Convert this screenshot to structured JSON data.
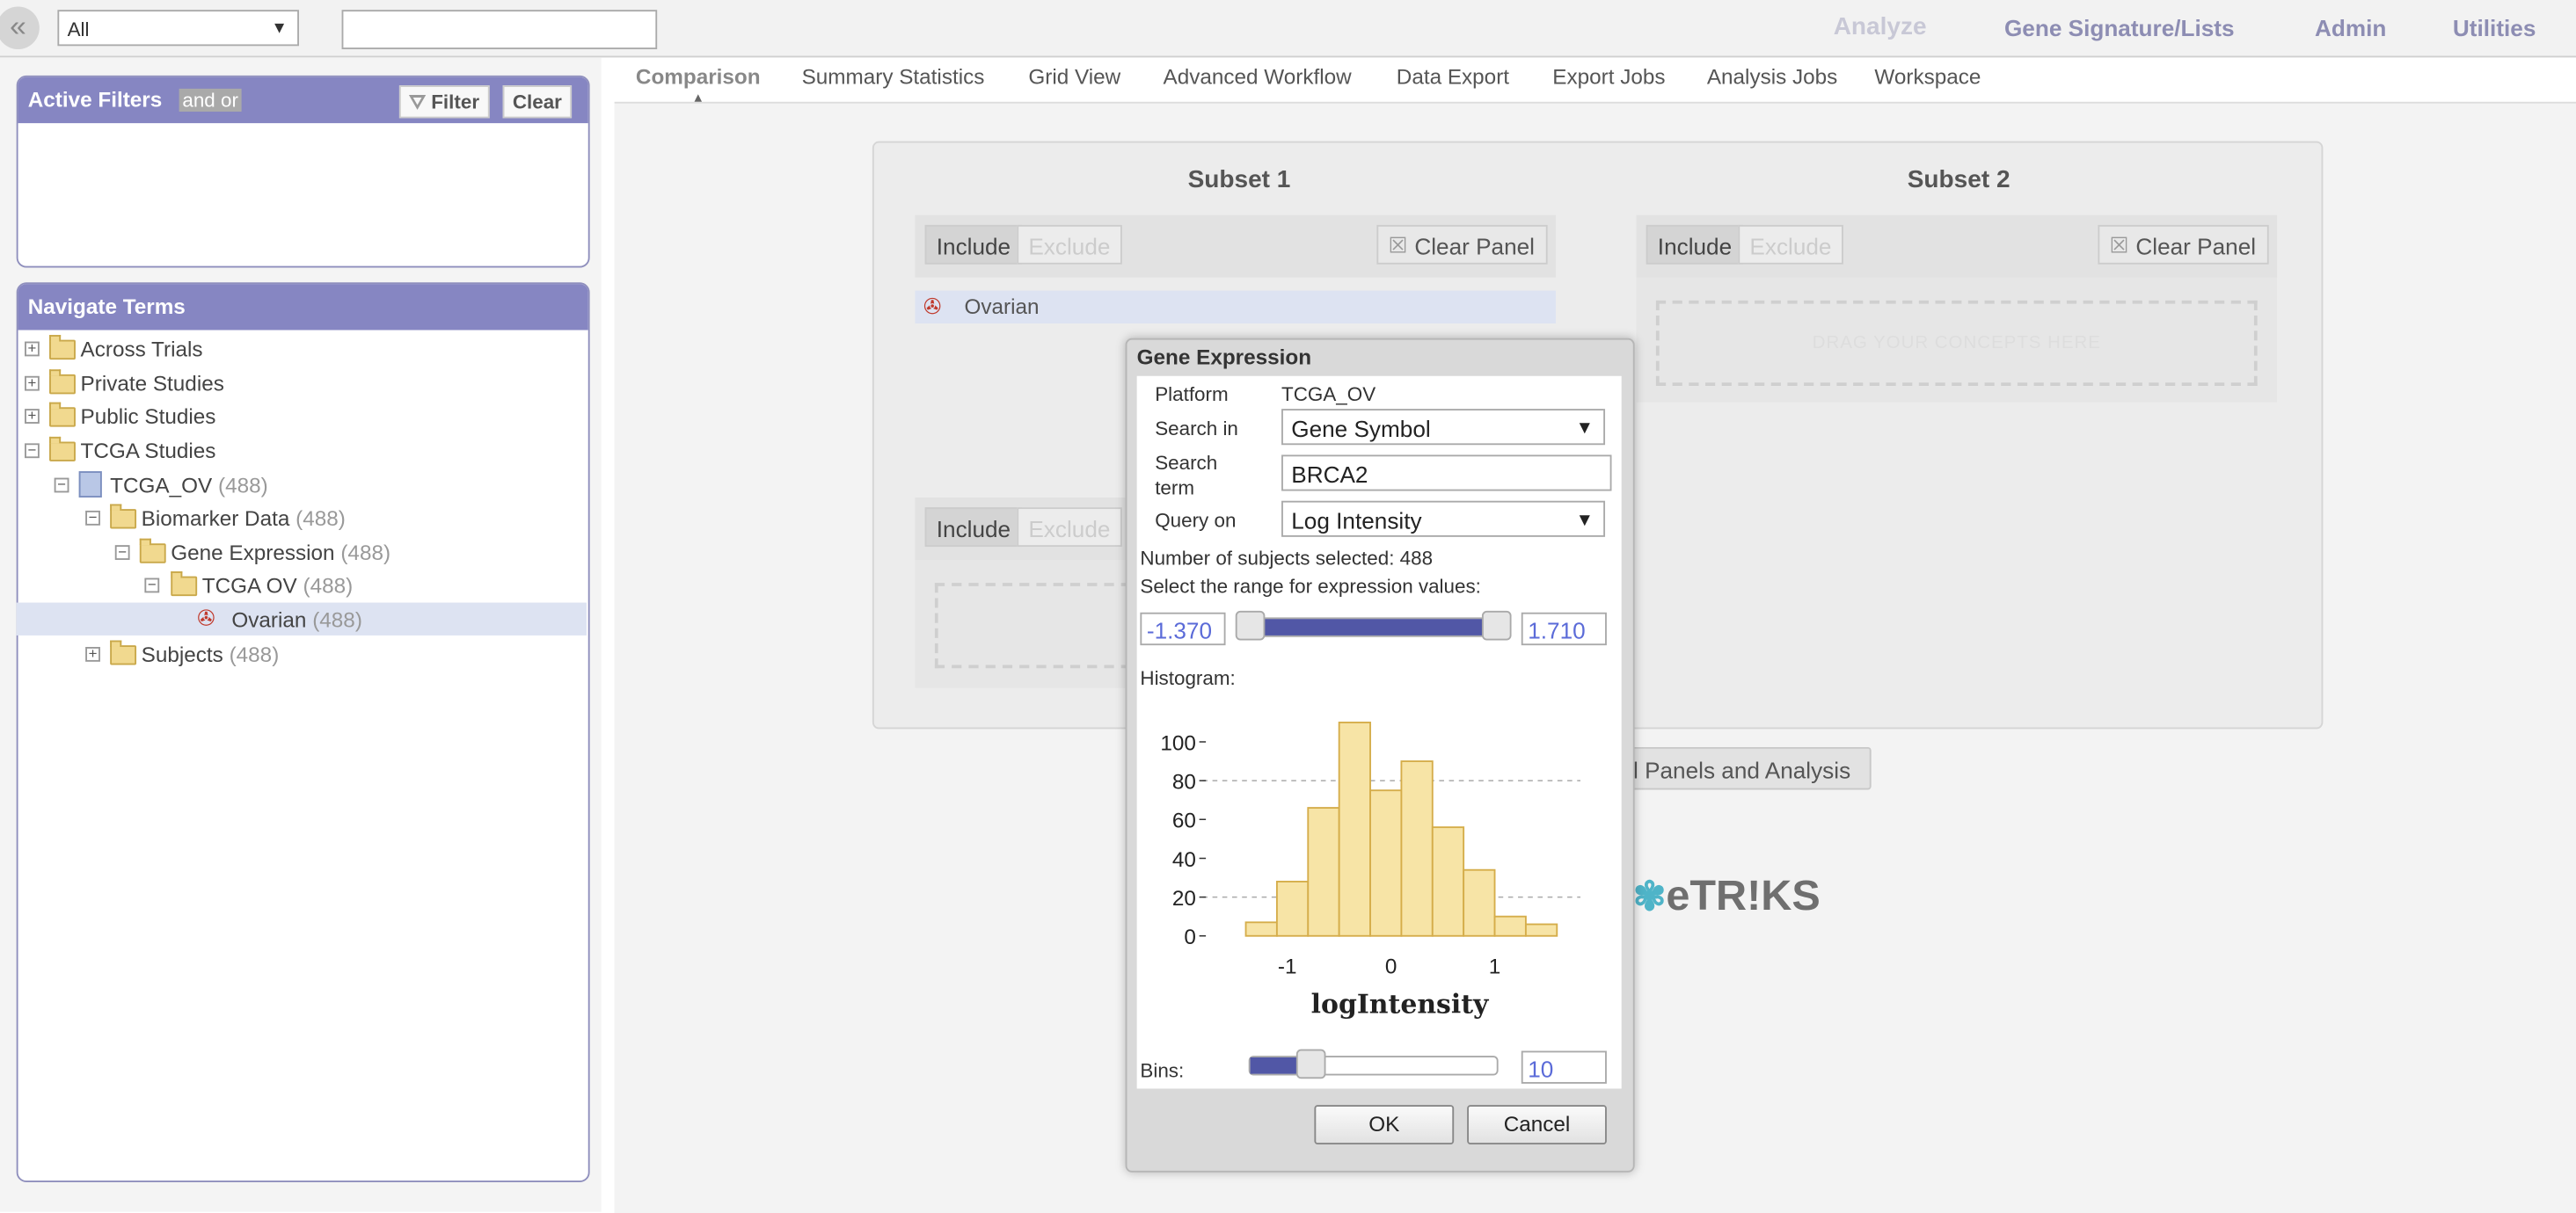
{
  "topbar": {
    "scope_select": "All",
    "menu": [
      "Analyze",
      "Gene Signature/Lists",
      "Admin",
      "Utilities"
    ]
  },
  "filters_panel": {
    "title": "Active Filters",
    "andor": "and or",
    "filter_button": "Filter",
    "clear_button": "Clear"
  },
  "nav_panel": {
    "title": "Navigate Terms",
    "tree": [
      {
        "label": "Across Trials",
        "count": ""
      },
      {
        "label": "Private Studies",
        "count": ""
      },
      {
        "label": "Public Studies",
        "count": ""
      },
      {
        "label": "TCGA Studies",
        "count": ""
      },
      {
        "label": "TCGA_OV",
        "count": "(488)"
      },
      {
        "label": "Biomarker Data",
        "count": "(488)"
      },
      {
        "label": "Gene Expression",
        "count": "(488)"
      },
      {
        "label": "TCGA OV",
        "count": "(488)"
      },
      {
        "label": "Ovarian",
        "count": "(488)"
      },
      {
        "label": "Subjects",
        "count": "(488)"
      }
    ]
  },
  "tabs": [
    "Comparison",
    "Summary Statistics",
    "Grid View",
    "Advanced Workflow",
    "Data Export",
    "Export Jobs",
    "Analysis Jobs",
    "Workspace"
  ],
  "comparison": {
    "subset1_title": "Subset 1",
    "subset2_title": "Subset 2",
    "include": "Include",
    "exclude": "Exclude",
    "clear_panel": "Clear Panel",
    "concept": "Ovarian",
    "dropzone_text": "DRAG YOUR CONCEPTS HERE",
    "dropzone_partial": "DR",
    "clear_all_button": "ll Panels and Analysis",
    "logo_text": "eTR!KS"
  },
  "dialog": {
    "title": "Gene Expression",
    "platform_label": "Platform",
    "platform_value": "TCGA_OV",
    "search_in_label": "Search in",
    "search_in_value": "Gene Symbol",
    "search_term_label_1": "Search",
    "search_term_label_2": "term",
    "search_term_value": "BRCA2",
    "query_on_label": "Query on",
    "query_on_value": "Log Intensity",
    "subjects_text": "Number of subjects selected: 488",
    "range_text": "Select the range for expression values:",
    "range_min": "-1.370",
    "range_max": "1.710",
    "histogram_label": "Histogram:",
    "bins_label": "Bins:",
    "bins_value": "10",
    "ok_button": "OK",
    "cancel_button": "Cancel"
  },
  "chart_data": {
    "type": "bar",
    "title": "",
    "xlabel": "logIntensity",
    "ylabel": "",
    "bin_edges": [
      -1.4,
      -1.1,
      -0.8,
      -0.5,
      -0.2,
      0.1,
      0.4,
      0.7,
      1.0,
      1.3,
      1.6
    ],
    "values": [
      7,
      28,
      66,
      110,
      75,
      90,
      56,
      34,
      10,
      6
    ],
    "xticks": [
      -1,
      0,
      1
    ],
    "yticks": [
      0,
      20,
      40,
      60,
      80,
      100
    ],
    "ylim": [
      0,
      110
    ],
    "xlim": [
      -1.5,
      1.7
    ],
    "grid_dashed_at": [
      20,
      80
    ],
    "colors": {
      "fill": "#f7e4a6",
      "stroke": "#d5ad4a"
    }
  },
  "colors": {
    "panel_header": "#8686c2",
    "menu_link": "#8d8db3",
    "slider_fill": "#5157a6",
    "input_value": "#5b6bd8"
  }
}
